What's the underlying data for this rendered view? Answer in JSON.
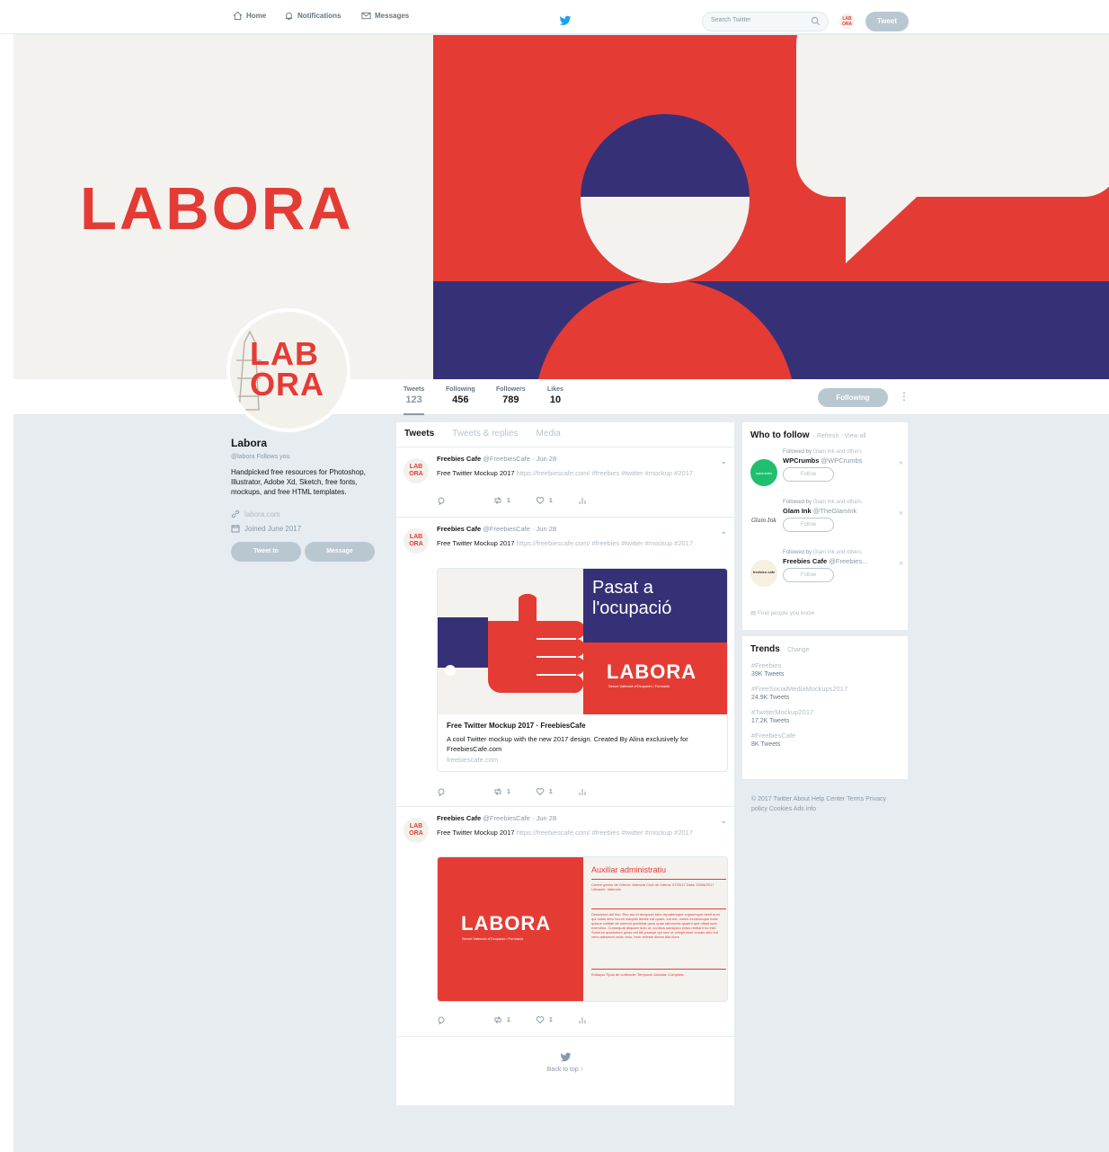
{
  "nav": {
    "home": "Home",
    "notifications": "Notifications",
    "messages": "Messages",
    "search_placeholder": "Search Twitter",
    "tweet_button": "Tweet",
    "mini_avatar": "LAB ORA"
  },
  "banner": {
    "word": "LABORA"
  },
  "avatar": {
    "text_line1": "LAB",
    "text_line2": "ORA"
  },
  "stats": {
    "tweets_label": "Tweets",
    "tweets_value": "123",
    "following_label": "Following",
    "following_value": "456",
    "followers_label": "Followers",
    "followers_value": "789",
    "likes_label": "Likes",
    "likes_value": "10",
    "following_button": "Following",
    "more": "⋮"
  },
  "profile": {
    "name": "Labora",
    "handle": "@labora Follows you",
    "bio": "Handpicked free resources for Photoshop, Illustrator, Adobe Xd, Sketch, free fonts, mockups, and free HTML templates.",
    "website": "labora.com",
    "joined": "Joined June 2017",
    "tweet_to": "Tweet to",
    "message": "Message"
  },
  "timeline": {
    "tabs": [
      "Tweets",
      "Tweets & replies",
      "Media"
    ],
    "tweets": [
      {
        "avatar": "LAB ORA",
        "name": "Freebies Cafe",
        "handle": "@FreebiesCafe · Jun 28",
        "text": "Free Twitter Mockup 2017",
        "link": "https://freebiescafe.com/ #freebies #twitter #mockup #2017",
        "reply": "",
        "retweets": "1",
        "likes": "1"
      },
      {
        "avatar": "LAB ORA",
        "name": "Freebies Cafe",
        "handle": "@FreebiesCafe · Jun 28",
        "text": "Free Twitter Mockup 2017",
        "link": "https://freebiescafe.com/ #freebies #twitter #mockup #2017",
        "reply": "",
        "retweets": "1",
        "likes": "1",
        "card": {
          "headline_line1": "Pasat a",
          "headline_line2": "l'ocupació",
          "word": "LABORA",
          "sub": "Servei Valencià d'Ocupació i Formació",
          "title": "Free Twitter Mockup 2017 · FreebiesCafe",
          "desc": "A cool Twitter mockup with the new 2017 design. Created By Alina exclusively for FreebiesCafe.com",
          "domain": "freebiescafe.com"
        }
      },
      {
        "avatar": "LAB ORA",
        "name": "Freebies Cafe",
        "handle": "@FreebiesCafe · Jun 28",
        "text": "Free Twitter Mockup 2017",
        "link": "https://freebiescafe.com/ #freebies #twitter #mockup #2017",
        "reply": "",
        "retweets": "1",
        "likes": "1",
        "card": {
          "word": "LABORA",
          "sub": "Servei Valencià d'Ocupació i Formació",
          "job_title": "Auxiliar administratiu",
          "job_block1": "Centre gestor de l'oferta: Valencia Codi de l'oferta: 07/2017 Data: 20/06/2017 Ubicació: Valencia",
          "job_block2": "Descripció del lloc: Rec aut et ducipsari tabo repratemque cupsumque denit eum qui nobis dero incum estquilo lbeate est quam, iud est, omnis exoleumque ectis quisue volitiae sit ommod quidebat quos quas laborumis quaeni que ofisat sunt exercimo. Consequat aliquam dolo ut, conibus saesporo ectus rentiant eu etst. Solorum quiaturium quias est tibi psaepe qui nos ve volupturuse conalo sitio ind verio alissirunt vsido visio, hem veleste dinam alio illore.",
          "job_block3": "Enllaços Tipus de contracte: Temporal Jornada: Completa"
        }
      }
    ],
    "back_to_top": "Back to top ↑"
  },
  "who_to_follow": {
    "title": "Who to follow",
    "refresh": "· Refresh · View all",
    "items": [
      {
        "followed_by": "Followed by",
        "followed_names": "Glam Ink and others",
        "name": "WPCrumbs",
        "handle": "@WPCrumbs",
        "follow": "Follow",
        "avatar_bg": "#1fbf6e",
        "avatar_text": "wpcrumbs"
      },
      {
        "followed_by": "Followed by",
        "followed_names": "Glam Ink and others",
        "name": "Glam Ink",
        "handle": "@TheGlamInk",
        "follow": "Follow",
        "avatar_bg": "#ffffff",
        "avatar_text": "Glam Ink"
      },
      {
        "followed_by": "Followed by",
        "followed_names": "Glam Ink and others",
        "name": "Freebies Cafe",
        "handle": "@Freebies...",
        "follow": "Follow",
        "avatar_bg": "#f7efe0",
        "avatar_text": "freebies cafe"
      }
    ],
    "find_people": "Find people you know"
  },
  "trends": {
    "title": "Trends",
    "change": "· Change",
    "items": [
      {
        "name": "#Freebies",
        "count": "39K Tweets"
      },
      {
        "name": "#FreeSocialMediaMockups2017",
        "count": "24.9K Tweets"
      },
      {
        "name": "#TwitterMockup2017",
        "count": "17.2K Tweets"
      },
      {
        "name": "#FreebiesCafe",
        "count": "8K Tweets"
      }
    ]
  },
  "footer": "© 2017 Twitter About Help Center Terms Privacy policy Cookies Ads info",
  "colors": {
    "labora_red": "#e43c35",
    "labora_navy": "#363077",
    "twitter_blue": "#1da1f2"
  }
}
